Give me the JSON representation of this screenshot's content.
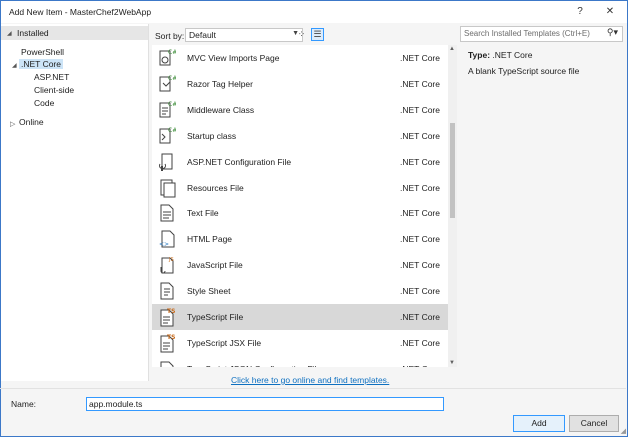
{
  "window": {
    "title": "Add New Item - MasterChef2WebApp",
    "help_label": "?",
    "close_label": "✕"
  },
  "left": {
    "installed_label": "Installed",
    "items": [
      "PowerShell",
      ".NET Core",
      "ASP.NET",
      "Client-side",
      "Code"
    ],
    "online_label": "Online"
  },
  "toolbar": {
    "sort_label": "Sort by:",
    "sort_value": "Default"
  },
  "templates": [
    {
      "name": "MVC View Imports Page",
      "tag": ".NET Core",
      "icon": "mvc-view-icon"
    },
    {
      "name": "Razor Tag Helper",
      "tag": ".NET Core",
      "icon": "razor-helper-icon"
    },
    {
      "name": "Middleware Class",
      "tag": ".NET Core",
      "icon": "middleware-class-icon"
    },
    {
      "name": "Startup class",
      "tag": ".NET Core",
      "icon": "startup-class-icon"
    },
    {
      "name": "ASP.NET Configuration File",
      "tag": ".NET Core",
      "icon": "config-file-icon"
    },
    {
      "name": "Resources File",
      "tag": ".NET Core",
      "icon": "resources-file-icon"
    },
    {
      "name": "Text File",
      "tag": ".NET Core",
      "icon": "text-file-icon"
    },
    {
      "name": "HTML Page",
      "tag": ".NET Core",
      "icon": "html-page-icon"
    },
    {
      "name": "JavaScript File",
      "tag": ".NET Core",
      "icon": "javascript-file-icon"
    },
    {
      "name": "Style Sheet",
      "tag": ".NET Core",
      "icon": "stylesheet-icon"
    },
    {
      "name": "TypeScript File",
      "tag": ".NET Core",
      "icon": "typescript-file-icon"
    },
    {
      "name": "TypeScript JSX File",
      "tag": ".NET Core",
      "icon": "typescript-jsx-icon"
    },
    {
      "name": "TypeScript JSON Configuration File",
      "tag": ".NET Core",
      "icon": "json-config-icon"
    }
  ],
  "selected_index": 10,
  "online_link": "Click here to go online and find templates.",
  "details": {
    "search_placeholder": "Search Installed Templates (Ctrl+E)",
    "type_label": "Type:",
    "type_value": ".NET Core",
    "description": "A blank TypeScript source file"
  },
  "footer": {
    "name_label": "Name:",
    "name_value": "app.module.ts",
    "add_label": "Add",
    "cancel_label": "Cancel"
  },
  "colors": {
    "accent": "#3399ff",
    "link": "#0e70c0",
    "selected_row": "#d8d8d8",
    "csharp_green": "#388a34",
    "ts_orange": "#c76a1a"
  }
}
